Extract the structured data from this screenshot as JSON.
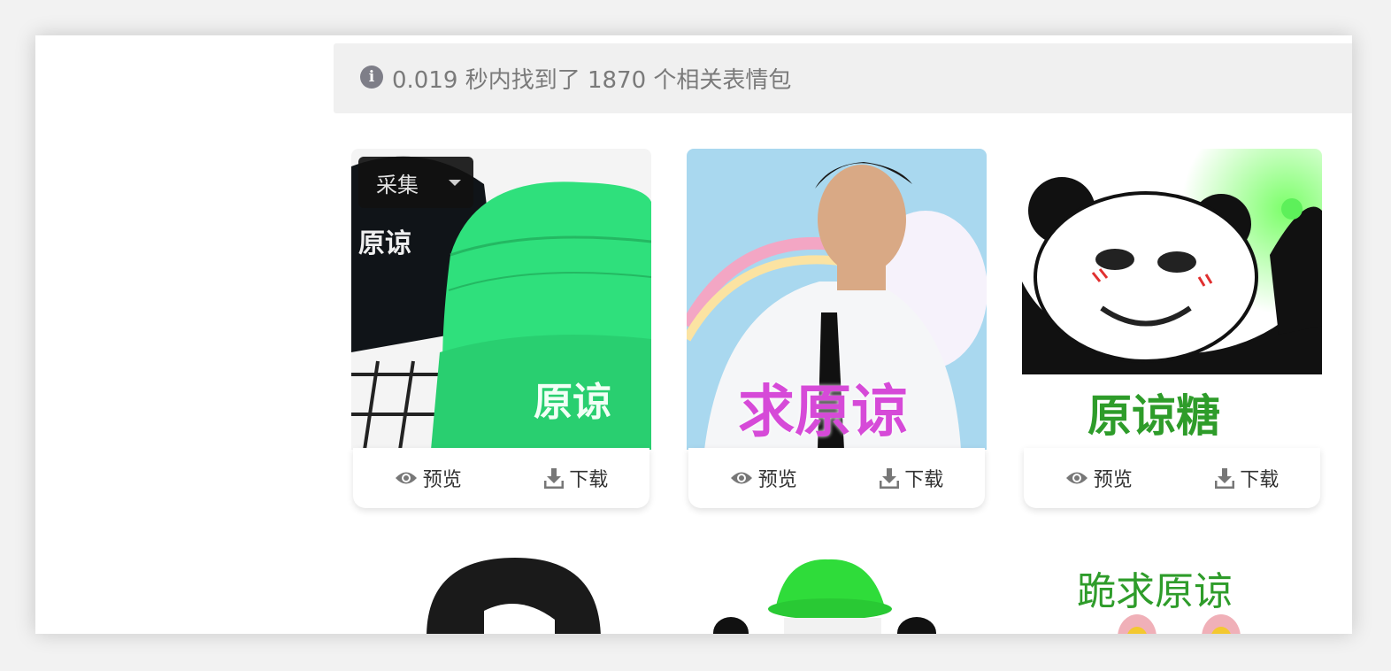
{
  "info": {
    "icon": "info-circle-icon",
    "text": "0.019 秒内找到了 1870 个相关表情包"
  },
  "collect": {
    "label": "采集"
  },
  "cards": [
    {
      "thumb_texts": [
        "原谅",
        "原谅"
      ],
      "preview_label": "预览",
      "download_label": "下载"
    },
    {
      "thumb_texts": [
        "求原谅"
      ],
      "preview_label": "预览",
      "download_label": "下载"
    },
    {
      "thumb_texts": [
        "原谅糖"
      ],
      "preview_label": "预览",
      "download_label": "下载"
    }
  ],
  "row2": [
    {
      "thumb_text": ""
    },
    {
      "thumb_text": ""
    },
    {
      "thumb_text": "跪求原谅"
    }
  ],
  "colors": {
    "hat_green": "#2fe07c",
    "text_green": "#2e9c2a",
    "sky_blue": "#a9d8ef",
    "magenta_text": "#d64ad8"
  }
}
